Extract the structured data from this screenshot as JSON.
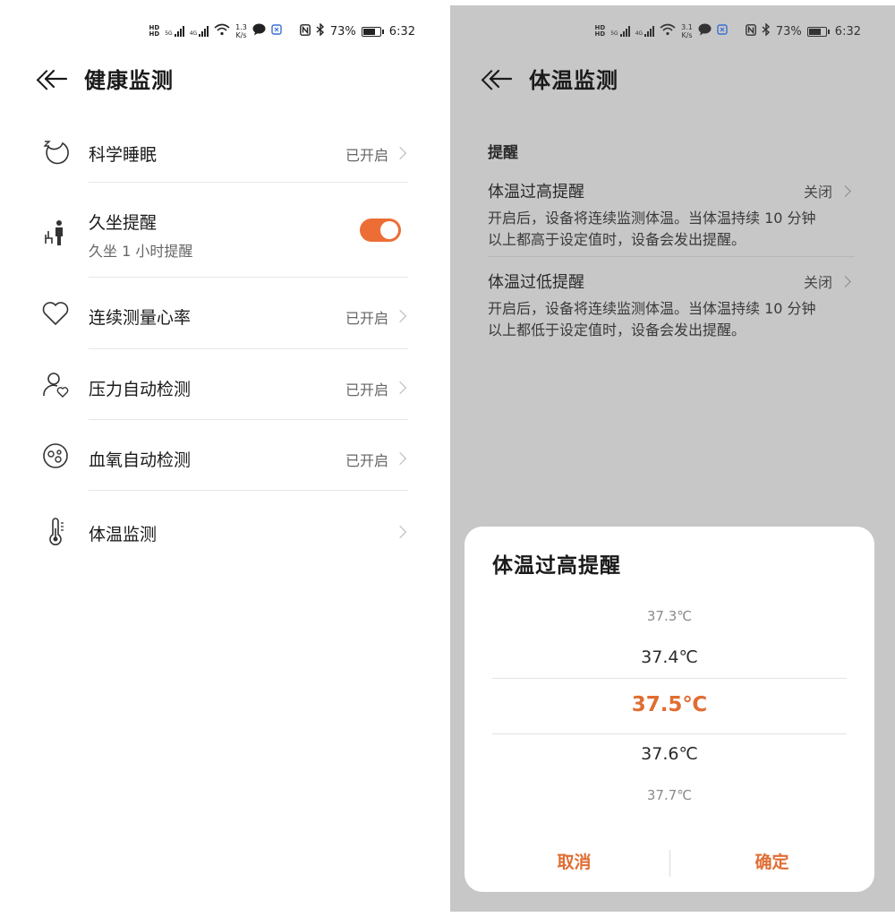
{
  "status_bar": {
    "left_speed_value": "1.3",
    "left_speed_unit": "K/s",
    "right_speed_value": "3.1",
    "right_speed_unit": "K/s",
    "network_a": "5G",
    "network_b": "4G",
    "battery": "73%",
    "time": "6:32"
  },
  "left_screen": {
    "title": "健康监测",
    "items": [
      {
        "label": "科学睡眠",
        "status": "已开启",
        "icon": "sleep-icon"
      },
      {
        "label": "久坐提醒",
        "sublabel": "久坐 1 小时提醒",
        "toggle_on": true,
        "icon": "sedentary-icon"
      },
      {
        "label": "连续测量心率",
        "status": "已开启",
        "icon": "heart-icon"
      },
      {
        "label": "压力自动检测",
        "status": "已开启",
        "icon": "stress-icon"
      },
      {
        "label": "血氧自动检测",
        "status": "已开启",
        "icon": "blood-oxygen-icon"
      },
      {
        "label": "体温监测",
        "status": "",
        "icon": "thermometer-icon"
      }
    ]
  },
  "right_screen": {
    "title": "体温监测",
    "section_header": "提醒",
    "settings": [
      {
        "title": "体温过高提醒",
        "value": "关闭",
        "desc_line1": "开启后，设备将连续监测体温。当体温持续 10 分钟",
        "desc_line2": "以上都高于设定值时，设备会发出提醒。"
      },
      {
        "title": "体温过低提醒",
        "value": "关闭",
        "desc_line1": "开启后，设备将连续监测体温。当体温持续 10 分钟",
        "desc_line2": "以上都低于设定值时，设备会发出提醒。"
      }
    ],
    "dialog": {
      "title": "体温过高提醒",
      "options": [
        "37.3℃",
        "37.4℃",
        "37.5℃",
        "37.6℃",
        "37.7℃"
      ],
      "selected": "37.5℃",
      "cancel_label": "取消",
      "confirm_label": "确定"
    }
  },
  "colors": {
    "accent": "#e06d33",
    "toggle_on": "#ec6e36",
    "overlay": "#c7c7c7"
  }
}
